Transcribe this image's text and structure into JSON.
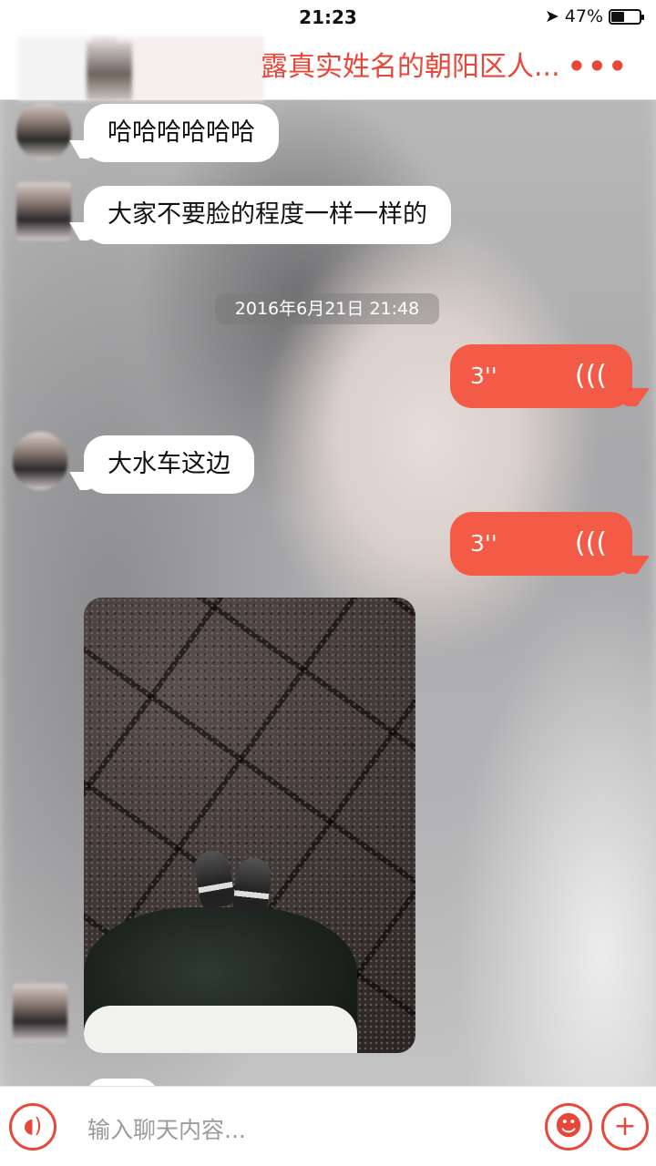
{
  "status_bar": {
    "time": "21:23",
    "location_icon": "location-arrow-icon",
    "battery_percent": "47%",
    "battery_level": 0.47
  },
  "nav": {
    "title": "露真实姓名的朝阳区人...",
    "more": "•••"
  },
  "messages": [
    {
      "type": "text",
      "direction": "in",
      "text": "哈哈哈哈哈哈"
    },
    {
      "type": "text",
      "direction": "in",
      "text": "大家不要脸的程度一样一样的"
    },
    {
      "type": "timestamp",
      "text": "2016年6月21日 21:48"
    },
    {
      "type": "voice",
      "direction": "out",
      "duration": "3''"
    },
    {
      "type": "text",
      "direction": "in",
      "text": "大水车这边"
    },
    {
      "type": "voice",
      "direction": "out",
      "duration": "3''"
    },
    {
      "type": "image",
      "direction": "in"
    }
  ],
  "input_bar": {
    "voice_icon": "voice-icon",
    "placeholder": "输入聊天内容...",
    "emoji_icon": "emoji-icon",
    "plus_icon": "plus-icon"
  },
  "colors": {
    "accent": "#e8473a",
    "outgoing_bubble": "#f45b47"
  }
}
